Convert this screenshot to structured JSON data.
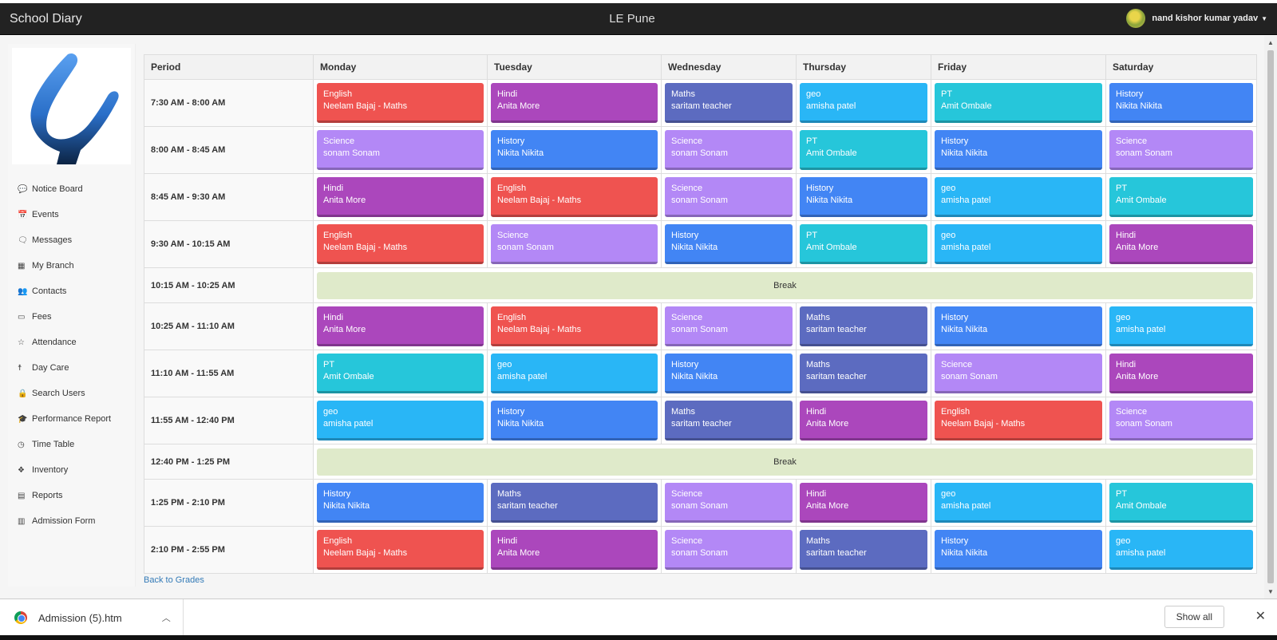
{
  "navbar": {
    "brand": "School Diary",
    "center_title": "LE Pune",
    "user_name": "nand kishor kumar yadav"
  },
  "sidebar": {
    "items": [
      {
        "label": "Notice Board",
        "icon": "comment-icon",
        "glyph": "💬"
      },
      {
        "label": "Events",
        "icon": "calendar-icon",
        "glyph": "📅"
      },
      {
        "label": "Messages",
        "icon": "messages-icon",
        "glyph": "🗨"
      },
      {
        "label": "My Branch",
        "icon": "building-icon",
        "glyph": "▦"
      },
      {
        "label": "Contacts",
        "icon": "users-icon",
        "glyph": "👥"
      },
      {
        "label": "Fees",
        "icon": "money-icon",
        "glyph": "▭"
      },
      {
        "label": "Attendance",
        "icon": "star-check-icon",
        "glyph": "☆"
      },
      {
        "label": "Day Care",
        "icon": "child-icon",
        "glyph": "☨"
      },
      {
        "label": "Search Users",
        "icon": "user-lock-icon",
        "glyph": "🔒"
      },
      {
        "label": "Performance Report",
        "icon": "graduation-cap-icon",
        "glyph": "🎓"
      },
      {
        "label": "Time Table",
        "icon": "clock-icon",
        "glyph": "◷"
      },
      {
        "label": "Inventory",
        "icon": "cubes-icon",
        "glyph": "❖"
      },
      {
        "label": "Reports",
        "icon": "book-icon",
        "glyph": "▤"
      },
      {
        "label": "Admission Form",
        "icon": "file-icon",
        "glyph": "▥"
      }
    ]
  },
  "timetable": {
    "headers": [
      "Period",
      "Monday",
      "Tuesday",
      "Wednesday",
      "Thursday",
      "Friday",
      "Saturday"
    ],
    "break_label": "Break",
    "rows": [
      {
        "period": "7:30 AM - 8:00 AM",
        "cells": [
          {
            "subject": "English",
            "teacher": "Neelam Bajaj - Maths",
            "color": "#ef5350"
          },
          {
            "subject": "Hindi",
            "teacher": "Anita More",
            "color": "#ab47bc"
          },
          {
            "subject": "Maths",
            "teacher": "saritam teacher",
            "color": "#5c6bc0"
          },
          {
            "subject": "geo",
            "teacher": "amisha patel",
            "color": "#29b6f6"
          },
          {
            "subject": "PT",
            "teacher": "Amit Ombale",
            "color": "#26c6da"
          },
          {
            "subject": "History",
            "teacher": "Nikita Nikita",
            "color": "#4285f4"
          }
        ]
      },
      {
        "period": "8:00 AM - 8:45 AM",
        "cells": [
          {
            "subject": "Science",
            "teacher": "sonam Sonam",
            "color": "#b388f6"
          },
          {
            "subject": "History",
            "teacher": "Nikita Nikita",
            "color": "#4285f4"
          },
          {
            "subject": "Science",
            "teacher": "sonam Sonam",
            "color": "#b388f6"
          },
          {
            "subject": "PT",
            "teacher": "Amit Ombale",
            "color": "#26c6da"
          },
          {
            "subject": "History",
            "teacher": "Nikita Nikita",
            "color": "#4285f4"
          },
          {
            "subject": "Science",
            "teacher": "sonam Sonam",
            "color": "#b388f6"
          }
        ]
      },
      {
        "period": "8:45 AM - 9:30 AM",
        "cells": [
          {
            "subject": "Hindi",
            "teacher": "Anita More",
            "color": "#ab47bc"
          },
          {
            "subject": "English",
            "teacher": "Neelam Bajaj - Maths",
            "color": "#ef5350"
          },
          {
            "subject": "Science",
            "teacher": "sonam Sonam",
            "color": "#b388f6"
          },
          {
            "subject": "History",
            "teacher": "Nikita Nikita",
            "color": "#4285f4"
          },
          {
            "subject": "geo",
            "teacher": "amisha patel",
            "color": "#29b6f6"
          },
          {
            "subject": "PT",
            "teacher": "Amit Ombale",
            "color": "#26c6da"
          }
        ]
      },
      {
        "period": "9:30 AM - 10:15 AM",
        "cells": [
          {
            "subject": "English",
            "teacher": "Neelam Bajaj - Maths",
            "color": "#ef5350"
          },
          {
            "subject": "Science",
            "teacher": "sonam Sonam",
            "color": "#b388f6"
          },
          {
            "subject": "History",
            "teacher": "Nikita Nikita",
            "color": "#4285f4"
          },
          {
            "subject": "PT",
            "teacher": "Amit Ombale",
            "color": "#26c6da"
          },
          {
            "subject": "geo",
            "teacher": "amisha patel",
            "color": "#29b6f6"
          },
          {
            "subject": "Hindi",
            "teacher": "Anita More",
            "color": "#ab47bc"
          }
        ]
      },
      {
        "period": "10:15 AM - 10:25 AM",
        "is_break": true
      },
      {
        "period": "10:25 AM - 11:10 AM",
        "cells": [
          {
            "subject": "Hindi",
            "teacher": "Anita More",
            "color": "#ab47bc"
          },
          {
            "subject": "English",
            "teacher": "Neelam Bajaj - Maths",
            "color": "#ef5350"
          },
          {
            "subject": "Science",
            "teacher": "sonam Sonam",
            "color": "#b388f6"
          },
          {
            "subject": "Maths",
            "teacher": "saritam teacher",
            "color": "#5c6bc0"
          },
          {
            "subject": "History",
            "teacher": "Nikita Nikita",
            "color": "#4285f4"
          },
          {
            "subject": "geo",
            "teacher": "amisha patel",
            "color": "#29b6f6"
          }
        ]
      },
      {
        "period": "11:10 AM - 11:55 AM",
        "cells": [
          {
            "subject": "PT",
            "teacher": "Amit Ombale",
            "color": "#26c6da"
          },
          {
            "subject": "geo",
            "teacher": "amisha patel",
            "color": "#29b6f6"
          },
          {
            "subject": "History",
            "teacher": "Nikita Nikita",
            "color": "#4285f4"
          },
          {
            "subject": "Maths",
            "teacher": "saritam teacher",
            "color": "#5c6bc0"
          },
          {
            "subject": "Science",
            "teacher": "sonam Sonam",
            "color": "#b388f6"
          },
          {
            "subject": "Hindi",
            "teacher": "Anita More",
            "color": "#ab47bc"
          }
        ]
      },
      {
        "period": "11:55 AM - 12:40 PM",
        "cells": [
          {
            "subject": "geo",
            "teacher": "amisha patel",
            "color": "#29b6f6"
          },
          {
            "subject": "History",
            "teacher": "Nikita Nikita",
            "color": "#4285f4"
          },
          {
            "subject": "Maths",
            "teacher": "saritam teacher",
            "color": "#5c6bc0"
          },
          {
            "subject": "Hindi",
            "teacher": "Anita More",
            "color": "#ab47bc"
          },
          {
            "subject": "English",
            "teacher": "Neelam Bajaj - Maths",
            "color": "#ef5350"
          },
          {
            "subject": "Science",
            "teacher": "sonam Sonam",
            "color": "#b388f6"
          }
        ]
      },
      {
        "period": "12:40 PM - 1:25 PM",
        "is_break": true
      },
      {
        "period": "1:25 PM - 2:10 PM",
        "cells": [
          {
            "subject": "History",
            "teacher": "Nikita Nikita",
            "color": "#4285f4"
          },
          {
            "subject": "Maths",
            "teacher": "saritam teacher",
            "color": "#5c6bc0"
          },
          {
            "subject": "Science",
            "teacher": "sonam Sonam",
            "color": "#b388f6"
          },
          {
            "subject": "Hindi",
            "teacher": "Anita More",
            "color": "#ab47bc"
          },
          {
            "subject": "geo",
            "teacher": "amisha patel",
            "color": "#29b6f6"
          },
          {
            "subject": "PT",
            "teacher": "Amit Ombale",
            "color": "#26c6da"
          }
        ]
      },
      {
        "period": "2:10 PM - 2:55 PM",
        "cells": [
          {
            "subject": "English",
            "teacher": "Neelam Bajaj - Maths",
            "color": "#ef5350"
          },
          {
            "subject": "Hindi",
            "teacher": "Anita More",
            "color": "#ab47bc"
          },
          {
            "subject": "Science",
            "teacher": "sonam Sonam",
            "color": "#b388f6"
          },
          {
            "subject": "Maths",
            "teacher": "saritam teacher",
            "color": "#5c6bc0"
          },
          {
            "subject": "History",
            "teacher": "Nikita Nikita",
            "color": "#4285f4"
          },
          {
            "subject": "geo",
            "teacher": "amisha patel",
            "color": "#29b6f6"
          }
        ]
      }
    ]
  },
  "back_link": "Back to Grades",
  "downloads": {
    "file_name": "Admission (5).htm",
    "show_all": "Show all"
  }
}
